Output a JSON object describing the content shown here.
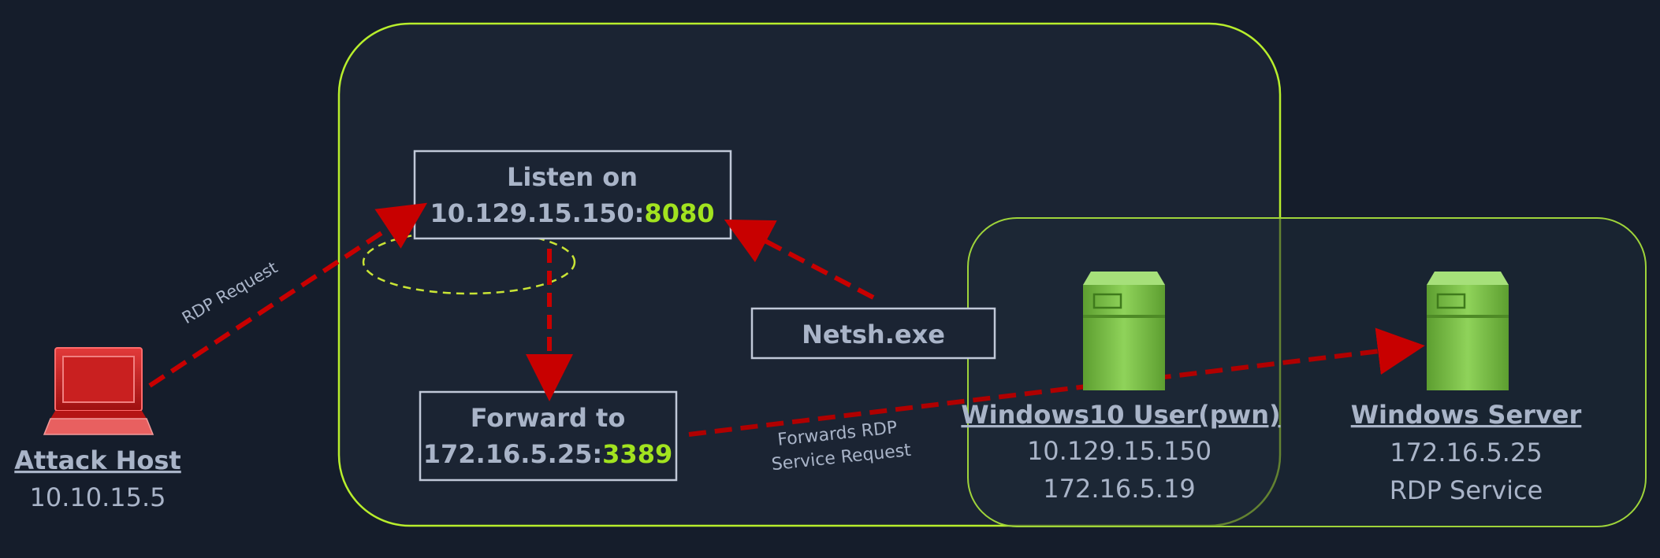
{
  "colors": {
    "background": "#151d2b",
    "zone_outline": "#b8ee2c",
    "zone_fill": "#1b2433",
    "box_border": "#c0c8d8",
    "label_text": "#a9b4c8",
    "port_highlight": "#a2e31f",
    "arrow": "#c80000",
    "server_green": "#78c043",
    "laptop_red": "#c41a1a",
    "loop_ellipse": "#c9e435"
  },
  "icons": {
    "attack_host": "laptop-icon",
    "windows10_user": "server-icon",
    "windows_server": "server-icon"
  },
  "listen_box": {
    "line1": "Listen on",
    "address": "10.129.15.150:",
    "port": "8080"
  },
  "forward_box": {
    "line1": "Forward to",
    "address": "172.16.5.25:",
    "port": "3389"
  },
  "netsh_box": {
    "label": "Netsh.exe"
  },
  "edges": {
    "rdp_request": "RDP Request",
    "forwards_line1": "Forwards RDP",
    "forwards_line2": "Service Request"
  },
  "attack_host": {
    "title": "Attack Host",
    "ip": "10.10.15.5"
  },
  "windows10_user": {
    "title": "Windows10 User(pwn)",
    "ip1": "10.129.15.150",
    "ip2": "172.16.5.19"
  },
  "windows_server": {
    "title": "Windows Server",
    "ip": "172.16.5.25",
    "service": "RDP Service"
  }
}
